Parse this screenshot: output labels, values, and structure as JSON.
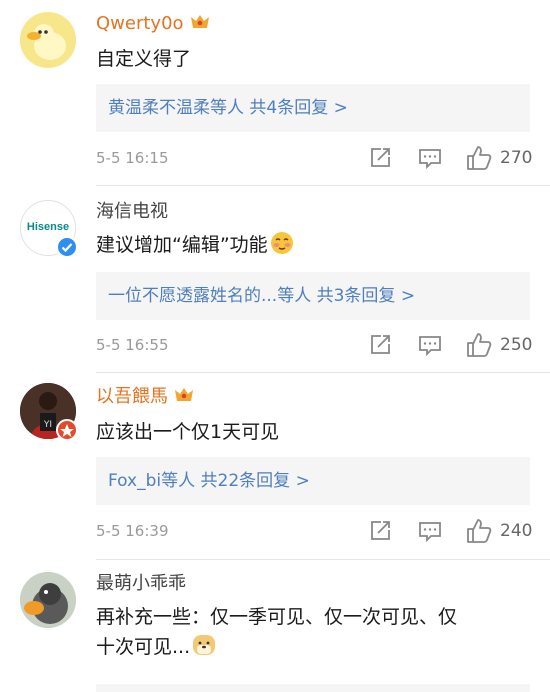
{
  "comments": [
    {
      "user": "Qwerty0o",
      "text": "自定义得了",
      "replies": "黄温柔不温柔等人  共4条回复 >",
      "time": "5-5 16:15",
      "likes": "270"
    },
    {
      "user": "海信电视",
      "avatar_text": "Hisense",
      "text": "建议增加“编辑”功能",
      "replies": "一位不愿透露姓名的...等人  共3条回复 >",
      "time": "5-5 16:55",
      "likes": "250"
    },
    {
      "user": "以吾餵馬",
      "text": "应该出一个仅1天可见",
      "replies": "Fox_bi等人  共22条回复 >",
      "time": "5-5 16:39",
      "likes": "240"
    },
    {
      "user": "最萌小乖乖",
      "text_line1": "再补充一些：仅一季可见、仅一次可见、仅",
      "text_line2": "十次可见..."
    }
  ],
  "colors": {
    "vip_name": "#e8731f",
    "reply_link": "#4f7fbe",
    "verified_badge": "#2e8ff0",
    "muted": "#9a9a9a"
  }
}
